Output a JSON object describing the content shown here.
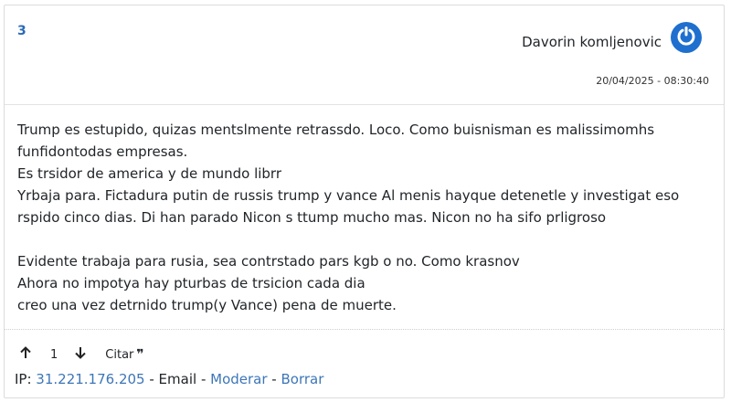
{
  "comment": {
    "number": "3",
    "author": "Davorin komljenovic",
    "timestamp": "20/04/2025 - 08:30:40",
    "avatar_icon": "power-icon",
    "avatar_color": "#1f6fcf",
    "body": {
      "line1": "Trump es estupido, quizas mentslmente retrassdo. Loco. Como buisnisman es malissimomhs funfidontodas empresas.",
      "line2": "Es trsidor de america y de mundo librr",
      "line3": "Yrbaja para. Fictadura putin de russis trump y vance Al menis hayque detenetle y investigat eso rspido cinco dias. Di han parado Nicon s ttump mucho mas. Nicon no ha sifo prligroso",
      "line4": "Evidente trabaja para rusia, sea contrstado pars kgb o no. Como krasnov",
      "line5": "Ahora no impotya hay pturbas de trsicion cada dia",
      "line6": "creo una vez detrnido trump(y Vance) pena de muerte."
    },
    "votes": {
      "count": "1",
      "up_icon": "arrow-up-icon",
      "down_icon": "arrow-down-icon"
    },
    "quote_label": "Citar",
    "quote_icon": "quote-icon",
    "meta": {
      "ip_label": "IP: ",
      "ip": "31.221.176.205",
      "sep1": " - ",
      "email": "Email",
      "sep2": " - ",
      "moderate": "Moderar",
      "sep3": " - ",
      "delete": "Borrar"
    },
    "link_color": "#3d76b8"
  }
}
